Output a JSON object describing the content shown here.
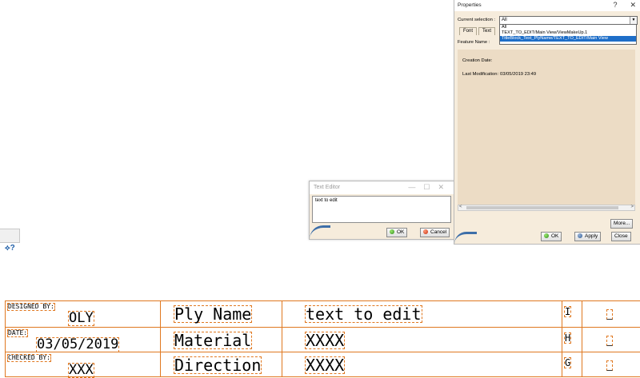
{
  "mini_toolbar": {
    "help_glyph": "⟡?"
  },
  "text_editor": {
    "title": "Text Editor",
    "minimize_glyph": "—",
    "maximize_glyph": "☐",
    "close_glyph": "✕",
    "content": "text to edit",
    "ok_label": "OK",
    "cancel_label": "Cancel"
  },
  "properties": {
    "title": "Properties",
    "help_glyph": "?",
    "close_glyph": "✕",
    "current_selection_label": "Current selection :",
    "current_selection_value": "All",
    "dropdown_options": [
      "All",
      "TEXT_TO_EDIT/Main View/ViewMakeUp.1",
      "TitleBlock_Text_PlyName/TEXT_TO_EDIT/Main View"
    ],
    "tabs": [
      "Font",
      "Text"
    ],
    "feature_name_label": "Feature Name :",
    "creation_date_label": "Creation Date:",
    "last_modification_label": "Last Modification:",
    "last_modification_value": "03/05/2019   23:49",
    "more_label": "More...",
    "ok_label": "OK",
    "apply_label": "Apply",
    "close_label": "Close"
  },
  "title_block": {
    "designed_by_label": "DESIGNED BY:",
    "designed_by_value": "OLY",
    "date_label": "DATE:",
    "date_value": "03/05/2019",
    "checked_by_label": "CHECKED BY:",
    "checked_by_value": "XXX",
    "rows": [
      {
        "field": "Ply Name",
        "value": "text to edit",
        "letter": "I"
      },
      {
        "field": "Material",
        "value": "XXXX",
        "letter": "H"
      },
      {
        "field": "Direction",
        "value": "XXXX",
        "letter": "G"
      }
    ]
  },
  "colors": {
    "cad_orange": "#e07820",
    "dialog_bg": "#f6ecdc",
    "selection_blue": "#1e6ec8"
  }
}
